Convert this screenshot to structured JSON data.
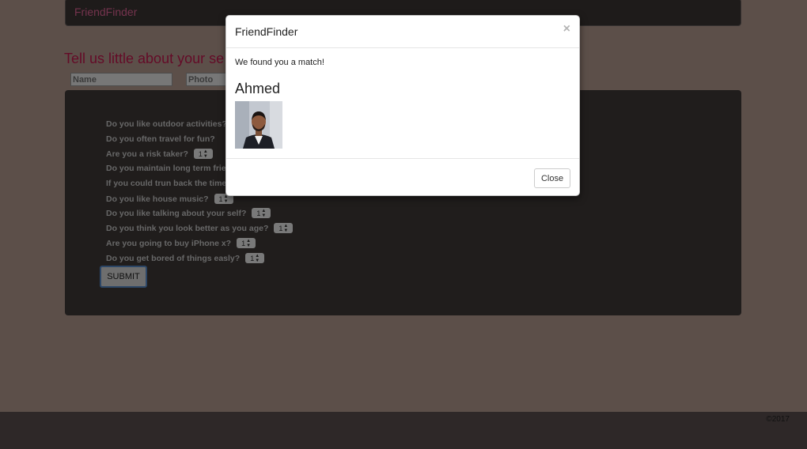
{
  "navbar": {
    "brand": "FriendFinder"
  },
  "survey": {
    "heading": "Tell us little about your se",
    "name_placeholder": "Name",
    "photo_placeholder": "Photo",
    "questions": [
      {
        "text": "Do you like outdoor activities?",
        "value": ""
      },
      {
        "text": "Do you often travel for fun?",
        "value": ""
      },
      {
        "text": "Are you a risk taker?",
        "value": "1"
      },
      {
        "text": "Do you maintain long term frie",
        "value": ""
      },
      {
        "text": "If you could trun back the time",
        "value": ""
      },
      {
        "text": "Do you like house music?",
        "value": "1"
      },
      {
        "text": "Do you like talking about your self?",
        "value": "1"
      },
      {
        "text": "Do you think you look better as you age?",
        "value": "1"
      },
      {
        "text": "Are you going to buy iPhone x?",
        "value": "1"
      },
      {
        "text": "Do you get bored of things easly?",
        "value": "1"
      }
    ],
    "submit_label": "SUBMIT"
  },
  "footer": {
    "copyright": "©2017"
  },
  "modal": {
    "title": "FriendFinder",
    "close_icon": "×",
    "message": "We found you a match!",
    "match_name": "Ahmed",
    "photo_icon": "person-photo",
    "close_label": "Close"
  },
  "colors": {
    "brand_pink": "#e8679a",
    "heading_red": "#c8174f",
    "panel_dark": "#403a39"
  }
}
